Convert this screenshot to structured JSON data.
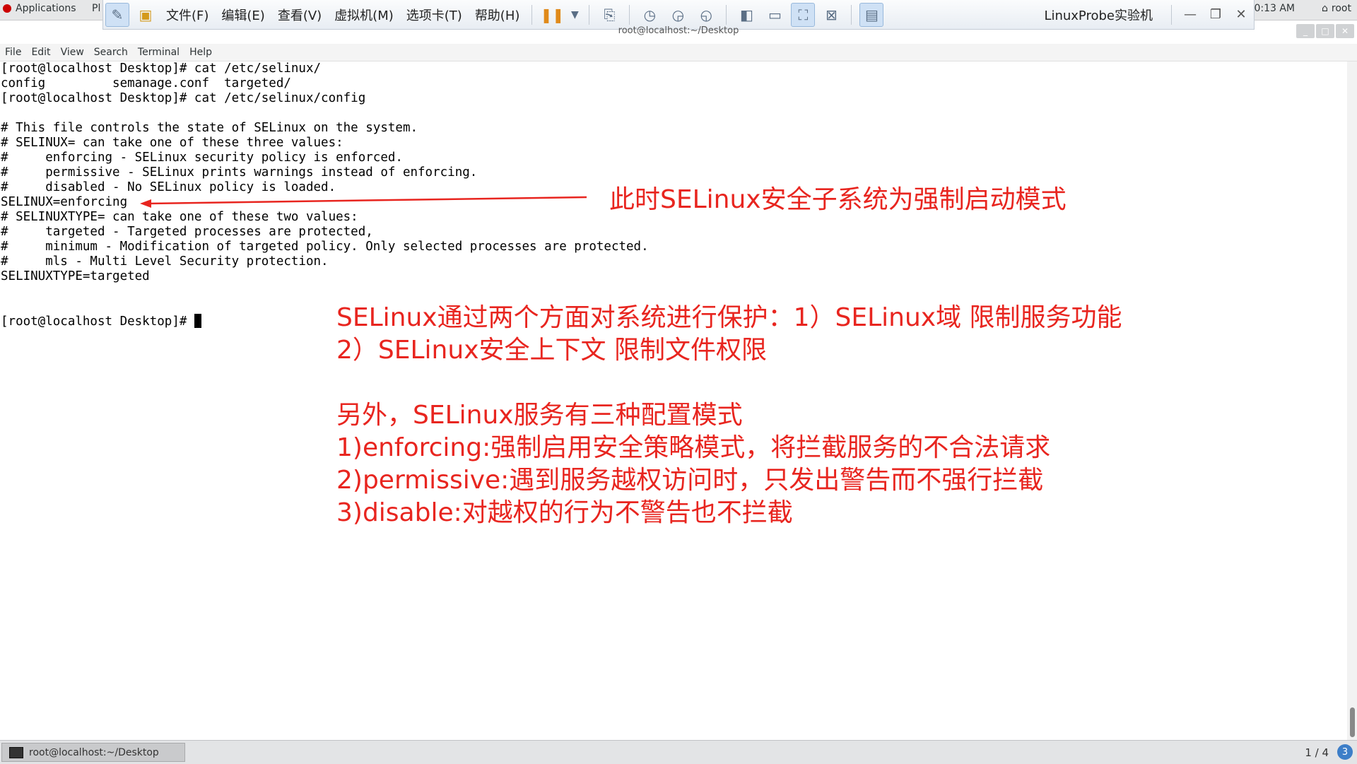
{
  "top_panel": {
    "applications_label": "Applications",
    "places_label": "Pl",
    "clock": "0:13 AM",
    "user": "root"
  },
  "vm_toolbar": {
    "menus": [
      "文件(F)",
      "编辑(E)",
      "查看(V)",
      "虚拟机(M)",
      "选项卡(T)",
      "帮助(H)"
    ],
    "title": "LinuxProbe实验机"
  },
  "terminal": {
    "window_title": "root@localhost:~/Desktop",
    "menubar": [
      "File",
      "Edit",
      "View",
      "Search",
      "Terminal",
      "Help"
    ],
    "lines": [
      "[root@localhost Desktop]# cat /etc/selinux/",
      "config         semanage.conf  targeted/",
      "[root@localhost Desktop]# cat /etc/selinux/config",
      "",
      "# This file controls the state of SELinux on the system.",
      "# SELINUX= can take one of these three values:",
      "#     enforcing - SELinux security policy is enforced.",
      "#     permissive - SELinux prints warnings instead of enforcing.",
      "#     disabled - No SELinux policy is loaded.",
      "SELINUX=enforcing",
      "# SELINUXTYPE= can take one of these two values:",
      "#     targeted - Targeted processes are protected,",
      "#     minimum - Modification of targeted policy. Only selected processes are protected.",
      "#     mls - Multi Level Security protection.",
      "SELINUXTYPE=targeted",
      "",
      ""
    ],
    "prompt": "[root@localhost Desktop]# "
  },
  "annotations": {
    "arrow_note": "此时SELinux安全子系统为强制启动模式",
    "line1": "SELinux通过两个方面对系统进行保护：1）SELinux域 限制服务功能",
    "line2": "2）SELinux安全上下文 限制文件权限",
    "line3": "另外，SELinux服务有三种配置模式",
    "line4": "1)enforcing:强制启用安全策略模式，将拦截服务的不合法请求",
    "line5": "2)permissive:遇到服务越权访问时，只发出警告而不强行拦截",
    "line6": "3)disable:对越权的行为不警告也不拦截",
    "color": "#e8251f"
  },
  "taskbar": {
    "task_label": "root@localhost:~/Desktop",
    "workspace": "1 / 4",
    "badge": "3"
  }
}
